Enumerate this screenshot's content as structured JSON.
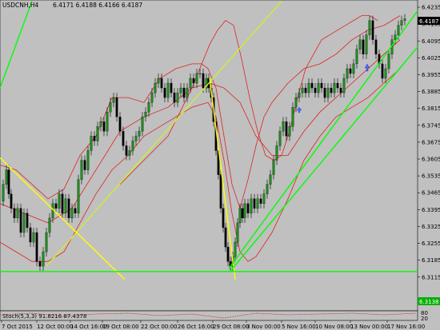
{
  "window": {
    "symbol_header": "USDCNH,H4",
    "ohlc": "6.4171 6.4188 6.4166 6.4187"
  },
  "indicator": {
    "label": "Stoch(5,3,3) 91.8216 87.4378",
    "levels": [
      "80",
      "20"
    ]
  },
  "price_tags": {
    "current": "6.4187",
    "support": "6.3138"
  },
  "chart_data": {
    "type": "line",
    "title": "",
    "ylim": [
      6.2975,
      6.4265
    ],
    "y_ticks": [
      "6.4235",
      "6.4165",
      "6.4095",
      "6.4025",
      "6.3955",
      "6.3885",
      "6.3815",
      "6.3745",
      "6.3675",
      "6.3605",
      "6.3535",
      "6.3465",
      "6.3395",
      "6.3325",
      "6.3255",
      "6.3185",
      "6.3115"
    ],
    "x_ticks": [
      "7 Oct 2015",
      "12 Oct 00:00",
      "14 Oct 16:00",
      "19 Oct 08:00",
      "22 Oct 00:00",
      "26 Oct 16:00",
      "29 Oct 08:00",
      "3 Nov 00:00",
      "5 Nov 16:00",
      "10 Nov 08:00",
      "13 Nov 00:00",
      "17 Nov 16:00"
    ],
    "close_path": [
      [
        0,
        6.343
      ],
      [
        4,
        6.35
      ],
      [
        8,
        6.356
      ],
      [
        11,
        6.346
      ],
      [
        14,
        6.34
      ],
      [
        18,
        6.336
      ],
      [
        22,
        6.34
      ],
      [
        26,
        6.33
      ],
      [
        30,
        6.338
      ],
      [
        34,
        6.332
      ],
      [
        38,
        6.326
      ],
      [
        42,
        6.33
      ],
      [
        46,
        6.318
      ],
      [
        50,
        6.316
      ],
      [
        54,
        6.322
      ],
      [
        58,
        6.33
      ],
      [
        62,
        6.336
      ],
      [
        66,
        6.342
      ],
      [
        70,
        6.34
      ],
      [
        74,
        6.346
      ],
      [
        78,
        6.338
      ],
      [
        82,
        6.344
      ],
      [
        86,
        6.336
      ],
      [
        90,
        6.34
      ],
      [
        94,
        6.338
      ],
      [
        98,
        6.352
      ],
      [
        102,
        6.36
      ],
      [
        106,
        6.356
      ],
      [
        110,
        6.364
      ],
      [
        114,
        6.37
      ],
      [
        118,
        6.368
      ],
      [
        122,
        6.374
      ],
      [
        126,
        6.376
      ],
      [
        130,
        6.372
      ],
      [
        134,
        6.38
      ],
      [
        138,
        6.384
      ],
      [
        142,
        6.386
      ],
      [
        146,
        6.378
      ],
      [
        150,
        6.372
      ],
      [
        154,
        6.366
      ],
      [
        158,
        6.362
      ],
      [
        162,
        6.364
      ],
      [
        166,
        6.368
      ],
      [
        170,
        6.37
      ],
      [
        174,
        6.372
      ],
      [
        178,
        6.378
      ],
      [
        182,
        6.38
      ],
      [
        186,
        6.384
      ],
      [
        190,
        6.388
      ],
      [
        194,
        6.392
      ],
      [
        198,
        6.394
      ],
      [
        202,
        6.39
      ],
      [
        206,
        6.386
      ],
      [
        210,
        6.392
      ],
      [
        214,
        6.388
      ],
      [
        218,
        6.384
      ],
      [
        222,
        6.388
      ],
      [
        226,
        6.39
      ],
      [
        230,
        6.386
      ],
      [
        234,
        6.39
      ],
      [
        238,
        6.394
      ],
      [
        242,
        6.392
      ],
      [
        246,
        6.396
      ],
      [
        250,
        6.396
      ],
      [
        254,
        6.39
      ],
      [
        258,
        6.394
      ],
      [
        261,
        6.39
      ],
      [
        264,
        6.386
      ],
      [
        267,
        6.376
      ],
      [
        270,
        6.364
      ],
      [
        273,
        6.354
      ],
      [
        276,
        6.34
      ],
      [
        279,
        6.332
      ],
      [
        282,
        6.324
      ],
      [
        285,
        6.318
      ],
      [
        288,
        6.316
      ],
      [
        291,
        6.32
      ],
      [
        294,
        6.326
      ],
      [
        297,
        6.334
      ],
      [
        300,
        6.34
      ],
      [
        303,
        6.336
      ],
      [
        306,
        6.342
      ],
      [
        310,
        6.338
      ],
      [
        314,
        6.344
      ],
      [
        318,
        6.34
      ],
      [
        322,
        6.344
      ],
      [
        326,
        6.342
      ],
      [
        330,
        6.346
      ],
      [
        334,
        6.35
      ],
      [
        338,
        6.354
      ],
      [
        342,
        6.36
      ],
      [
        346,
        6.366
      ],
      [
        350,
        6.372
      ],
      [
        354,
        6.376
      ],
      [
        358,
        6.37
      ],
      [
        362,
        6.374
      ],
      [
        366,
        6.382
      ],
      [
        370,
        6.386
      ],
      [
        374,
        6.388
      ],
      [
        378,
        6.39
      ],
      [
        382,
        6.388
      ],
      [
        386,
        6.392
      ],
      [
        390,
        6.39
      ],
      [
        394,
        6.388
      ],
      [
        398,
        6.392
      ],
      [
        402,
        6.39
      ],
      [
        406,
        6.386
      ],
      [
        410,
        6.39
      ],
      [
        414,
        6.388
      ],
      [
        418,
        6.392
      ],
      [
        422,
        6.39
      ],
      [
        426,
        6.388
      ],
      [
        430,
        6.394
      ],
      [
        434,
        6.398
      ],
      [
        438,
        6.396
      ],
      [
        442,
        6.4
      ],
      [
        446,
        6.406
      ],
      [
        450,
        6.41
      ],
      [
        454,
        6.404
      ],
      [
        458,
        6.412
      ],
      [
        462,
        6.418
      ],
      [
        466,
        6.41
      ],
      [
        470,
        6.404
      ],
      [
        474,
        6.4
      ],
      [
        478,
        6.394
      ],
      [
        482,
        6.398
      ],
      [
        486,
        6.404
      ],
      [
        490,
        6.41
      ],
      [
        494,
        6.412
      ],
      [
        498,
        6.416
      ],
      [
        502,
        6.418
      ],
      [
        506,
        6.4187
      ]
    ],
    "trendlines": [
      {
        "color": "#00ff00",
        "from": [
          0,
          6.39
        ],
        "to": [
          40,
          6.426
        ]
      },
      {
        "color": "#ccee33",
        "from": [
          58,
          6.316
        ],
        "to": [
          352,
          6.426
        ]
      },
      {
        "color": "#ffff00",
        "from": [
          0,
          6.361
        ],
        "to": [
          156,
          6.3105
        ]
      },
      {
        "color": "#ffff00",
        "from": [
          262,
          6.394
        ],
        "to": [
          294,
          6.3105
        ]
      },
      {
        "color": "#00ff00",
        "from": [
          286,
          6.315
        ],
        "to": [
          522,
          6.422
        ]
      },
      {
        "color": "#00ff00",
        "from": [
          288,
          6.314
        ],
        "to": [
          522,
          6.407
        ]
      },
      {
        "color": "#00ff00",
        "from": [
          0,
          6.3138
        ],
        "to": [
          522,
          6.3138
        ]
      }
    ],
    "bands": {
      "color": "#dd2222",
      "upper": [
        [
          0,
          6.358
        ],
        [
          20,
          6.356
        ],
        [
          40,
          6.35
        ],
        [
          60,
          6.344
        ],
        [
          80,
          6.348
        ],
        [
          100,
          6.362
        ],
        [
          120,
          6.37
        ],
        [
          140,
          6.386
        ],
        [
          160,
          6.386
        ],
        [
          180,
          6.384
        ],
        [
          200,
          6.394
        ],
        [
          220,
          6.398
        ],
        [
          240,
          6.4
        ],
        [
          252,
          6.4
        ],
        [
          260,
          6.398
        ],
        [
          270,
          6.39
        ],
        [
          280,
          6.37
        ],
        [
          290,
          6.35
        ],
        [
          300,
          6.34
        ],
        [
          310,
          6.352
        ],
        [
          320,
          6.366
        ],
        [
          330,
          6.378
        ],
        [
          340,
          6.384
        ],
        [
          350,
          6.388
        ],
        [
          360,
          6.392
        ],
        [
          380,
          6.398
        ],
        [
          400,
          6.4
        ],
        [
          420,
          6.404
        ],
        [
          440,
          6.41
        ],
        [
          460,
          6.414
        ],
        [
          480,
          6.416
        ],
        [
          500,
          6.42
        ]
      ],
      "middle": [
        [
          0,
          6.342
        ],
        [
          30,
          6.338
        ],
        [
          60,
          6.334
        ],
        [
          90,
          6.34
        ],
        [
          120,
          6.356
        ],
        [
          150,
          6.372
        ],
        [
          180,
          6.378
        ],
        [
          210,
          6.382
        ],
        [
          240,
          6.39
        ],
        [
          262,
          6.392
        ],
        [
          280,
          6.39
        ],
        [
          300,
          6.384
        ],
        [
          320,
          6.37
        ],
        [
          340,
          6.362
        ],
        [
          360,
          6.362
        ],
        [
          380,
          6.372
        ],
        [
          400,
          6.38
        ],
        [
          420,
          6.386
        ],
        [
          440,
          6.392
        ],
        [
          460,
          6.398
        ],
        [
          480,
          6.404
        ],
        [
          500,
          6.41
        ]
      ],
      "lower": [
        [
          0,
          6.326
        ],
        [
          20,
          6.322
        ],
        [
          40,
          6.318
        ],
        [
          60,
          6.318
        ],
        [
          80,
          6.322
        ],
        [
          100,
          6.334
        ],
        [
          120,
          6.346
        ],
        [
          140,
          6.356
        ],
        [
          160,
          6.362
        ],
        [
          180,
          6.37
        ],
        [
          200,
          6.374
        ],
        [
          220,
          6.378
        ],
        [
          240,
          6.382
        ],
        [
          260,
          6.384
        ],
        [
          270,
          6.378
        ],
        [
          280,
          6.36
        ],
        [
          290,
          6.338
        ],
        [
          300,
          6.322
        ],
        [
          310,
          6.318
        ],
        [
          320,
          6.32
        ],
        [
          340,
          6.33
        ],
        [
          360,
          6.344
        ],
        [
          380,
          6.36
        ],
        [
          400,
          6.37
        ],
        [
          420,
          6.378
        ],
        [
          440,
          6.382
        ],
        [
          460,
          6.386
        ],
        [
          480,
          6.392
        ],
        [
          500,
          6.398
        ]
      ]
    },
    "ma": {
      "color": "#dd2222",
      "values": [
        [
          150,
          6.35
        ],
        [
          180,
          6.36
        ],
        [
          210,
          6.37
        ],
        [
          240,
          6.39
        ],
        [
          262,
          6.408
        ],
        [
          272,
          6.414
        ],
        [
          282,
          6.418
        ],
        [
          292,
          6.416
        ],
        [
          302,
          6.402
        ],
        [
          312,
          6.386
        ],
        [
          322,
          6.372
        ],
        [
          332,
          6.362
        ],
        [
          342,
          6.36
        ],
        [
          352,
          6.362
        ],
        [
          362,
          6.372
        ],
        [
          372,
          6.386
        ],
        [
          382,
          6.398
        ],
        [
          392,
          6.404
        ],
        [
          402,
          6.41
        ],
        [
          412,
          6.412
        ],
        [
          422,
          6.414
        ],
        [
          432,
          6.416
        ],
        [
          442,
          6.418
        ],
        [
          452,
          6.42
        ],
        [
          462,
          6.42
        ],
        [
          472,
          6.418
        ]
      ]
    }
  }
}
